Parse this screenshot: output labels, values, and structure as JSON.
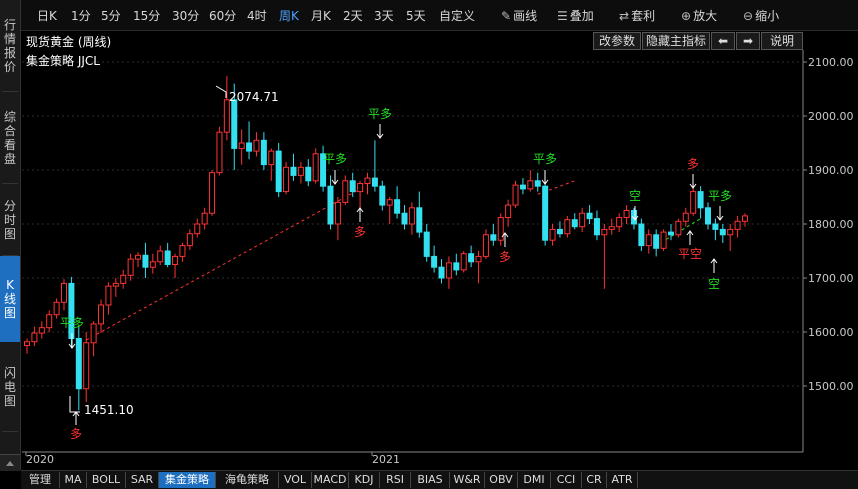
{
  "left_tabs": [
    {
      "label": "行情报价",
      "active": false
    },
    {
      "label": "综合看盘",
      "active": false
    },
    {
      "label": "分时图",
      "active": false
    },
    {
      "label": "K线图",
      "active": true
    },
    {
      "label": "闪电图",
      "active": false
    }
  ],
  "toolbar": {
    "periods": [
      "日K",
      "1分",
      "5分",
      "15分",
      "30分",
      "60分",
      "4时",
      "周K",
      "月K",
      "2天",
      "3天",
      "5天",
      "自定义"
    ],
    "active_period": "周K",
    "draw_label": "画线",
    "overlay_label": "叠加",
    "combine_label": "套利",
    "zoom_in_label": "放大",
    "zoom_out_label": "缩小"
  },
  "chart_header": {
    "title": "现货黄金 (周线)",
    "buttons": [
      "改参数",
      "隐藏主指标",
      "⬅",
      "➡",
      "说明"
    ]
  },
  "indicator_name": "集金策略 JJCL",
  "chart_data": {
    "type": "candlestick",
    "y_axis_labels": [
      "2100.00",
      "2000.00",
      "1900.00",
      "1800.00",
      "1700.00",
      "1600.00",
      "1500.00"
    ],
    "x_axis_labels": [
      "2020",
      "2021"
    ],
    "ylim": [
      1410,
      2110
    ],
    "up_color": "#ff3333",
    "down_color": "#33e0f0",
    "annotations": {
      "high_label": "2074.71",
      "low_label": "1451.10"
    },
    "signals": [
      {
        "text": "平多",
        "color": "#22dd22"
      },
      {
        "text": "多",
        "color": "#ff3333"
      },
      {
        "text": "平多",
        "color": "#22dd22"
      },
      {
        "text": "多",
        "color": "#ff3333"
      },
      {
        "text": "平多",
        "color": "#22dd22"
      },
      {
        "text": "多",
        "color": "#ff3333"
      },
      {
        "text": "平多",
        "color": "#22dd22"
      },
      {
        "text": "空",
        "color": "#22dd22"
      },
      {
        "text": "多",
        "color": "#ff3333"
      },
      {
        "text": "平空",
        "color": "#ff3333"
      },
      {
        "text": "平多",
        "color": "#22dd22"
      },
      {
        "text": "空",
        "color": "#22dd22"
      }
    ]
  },
  "bottom_tabs": [
    "管理",
    "MA",
    "BOLL",
    "SAR",
    "集金策略",
    "海龟策略",
    "VOL",
    "MACD",
    "KDJ",
    "RSI",
    "BIAS",
    "W&R",
    "OBV",
    "DMI",
    "CCI",
    "CR",
    "ATR"
  ],
  "active_bottom_tab": "集金策略"
}
